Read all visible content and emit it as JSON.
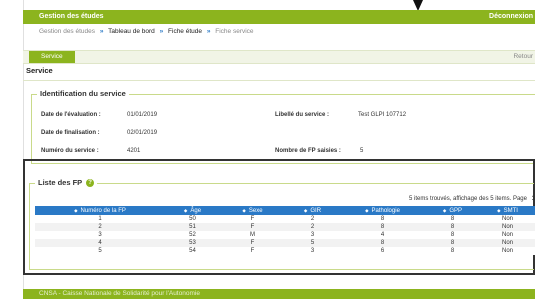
{
  "header": {
    "app_name": "Gestion des études",
    "logout_label": "Déconnexion"
  },
  "breadcrumb": [
    {
      "label": "Gestion des études"
    },
    {
      "label": "Tableau de bord"
    },
    {
      "label": "Fiche étude"
    },
    {
      "label": "Fiche service"
    }
  ],
  "breadcrumb_sep": "»",
  "tabs": {
    "active": "Service",
    "back_label": "Retour"
  },
  "page_title": "Service",
  "identification": {
    "title": "Identification du service",
    "eval_date_label": "Date de l'évaluation :",
    "eval_date": "01/01/2019",
    "end_date_label": "Date de finalisation :",
    "end_date": "02/01/2019",
    "number_label": "Numéro du service :",
    "number": "4201",
    "service_label": "Libellé du service :",
    "service_name": "Test GLPI 107712",
    "fp_count_label": "Nombre de FP saisies :",
    "fp_count": "5"
  },
  "fp_list": {
    "title": "Liste des FP",
    "help_glyph": "?",
    "summary": "5 items trouvés, affichage des 5 items. Page",
    "page": "1",
    "sort_glyph": "◆",
    "columns": [
      "Numéro de la FP",
      "Âge",
      "Sexe",
      "GIR",
      "Pathologie",
      "GPP",
      "SMTI"
    ],
    "rows": [
      [
        "1",
        "50",
        "F",
        "2",
        "8",
        "8",
        "Non"
      ],
      [
        "2",
        "51",
        "F",
        "2",
        "8",
        "8",
        "Non"
      ],
      [
        "3",
        "52",
        "M",
        "3",
        "4",
        "8",
        "Non"
      ],
      [
        "4",
        "53",
        "F",
        "5",
        "8",
        "8",
        "Non"
      ],
      [
        "5",
        "54",
        "F",
        "3",
        "6",
        "8",
        "Non"
      ]
    ]
  },
  "footer": {
    "text": "CNSA - Caisse Nationale de Solidarité pour l'Autonomie"
  },
  "colors": {
    "brand_green": "#8cb41e",
    "table_header_blue": "#2a79c6"
  }
}
